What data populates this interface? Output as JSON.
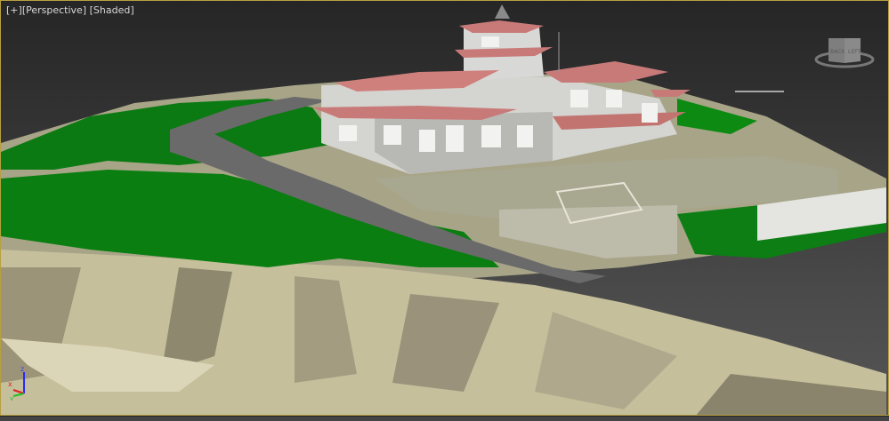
{
  "viewport": {
    "label_plus": "[+]",
    "label_view": "[Perspective]",
    "label_shading": "[Shaded]",
    "viewcube": {
      "face_left": "BACK",
      "face_right": "LEFT"
    },
    "axis": {
      "z": "z",
      "x": "x",
      "y": "y"
    }
  },
  "colors": {
    "border": "#b8a040",
    "terrain": "#c8c0a0",
    "grass": "#0a7a10",
    "roof": "#c87a78",
    "building": "#d8d8d8"
  }
}
